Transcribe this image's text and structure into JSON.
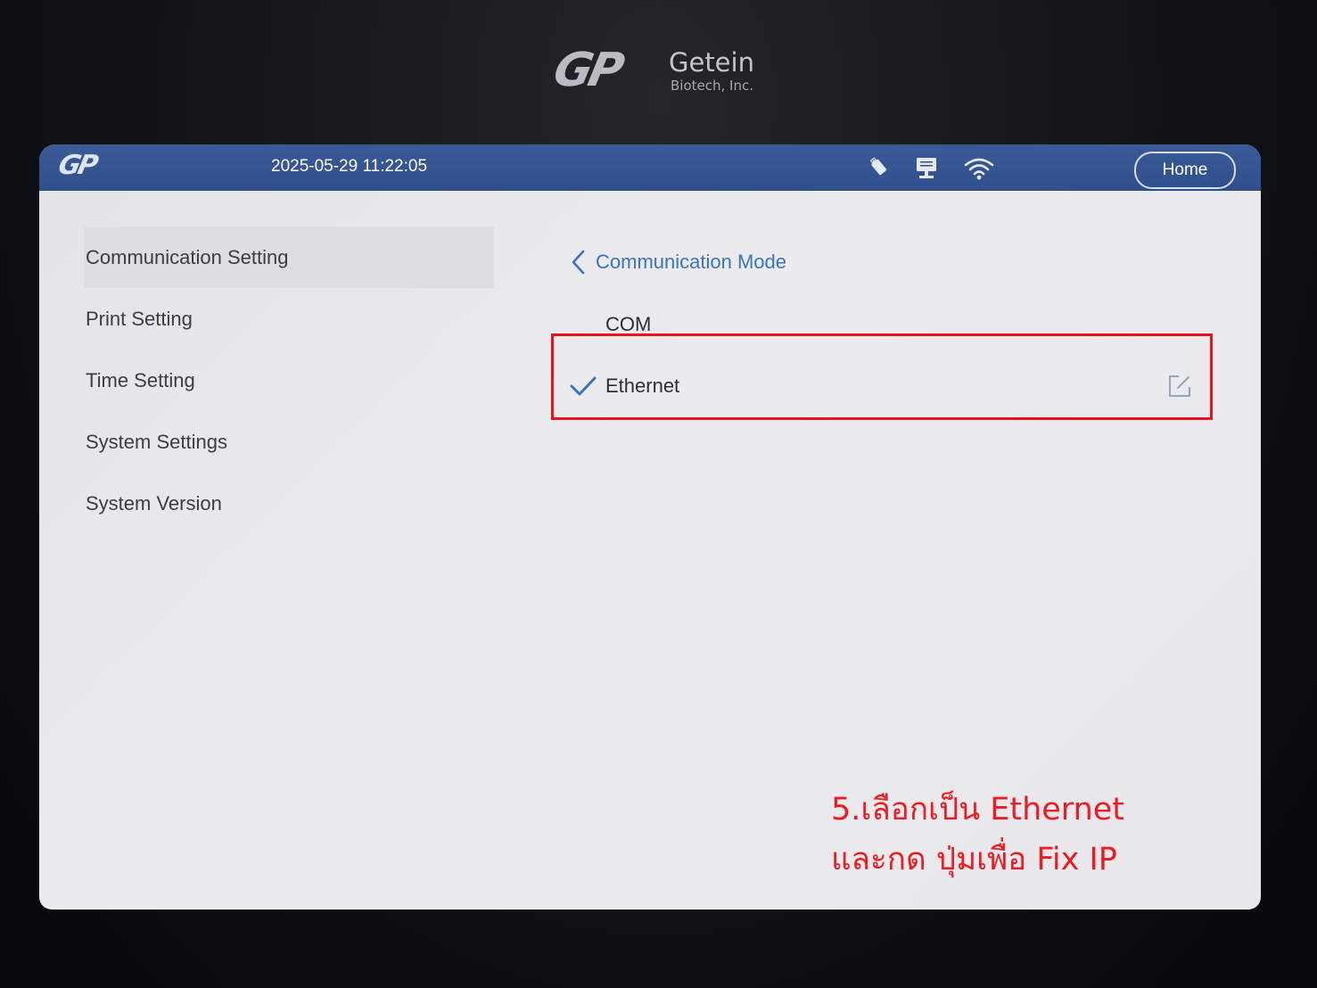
{
  "device": {
    "brand_mark": "GP",
    "brand_name": "Getein",
    "brand_subtitle": "Biotech, Inc."
  },
  "statusbar": {
    "logo": "GP",
    "datetime": "2025-05-29 11:22:05",
    "icons": [
      "usb-icon",
      "lan-icon",
      "wifi-icon"
    ],
    "home_label": "Home"
  },
  "menu": {
    "items": [
      {
        "label": "Communication Setting",
        "active": true
      },
      {
        "label": "Print Setting",
        "active": false
      },
      {
        "label": "Time Setting",
        "active": false
      },
      {
        "label": "System Settings",
        "active": false
      },
      {
        "label": "System Version",
        "active": false
      }
    ]
  },
  "detail": {
    "title": "Communication Mode",
    "options": [
      {
        "label": "COM",
        "selected": false,
        "editable": false
      },
      {
        "label": "Ethernet",
        "selected": true,
        "editable": true
      }
    ]
  },
  "annotation": {
    "line1": "5.เลือกเป็น Ethernet",
    "line2": "และกด ปุ่มเพื่อ Fix IP",
    "color": "#ee1c22"
  },
  "colors": {
    "statusbar": "#2f4f8c",
    "accent": "#3a74bf",
    "highlight": "#e8141b"
  }
}
